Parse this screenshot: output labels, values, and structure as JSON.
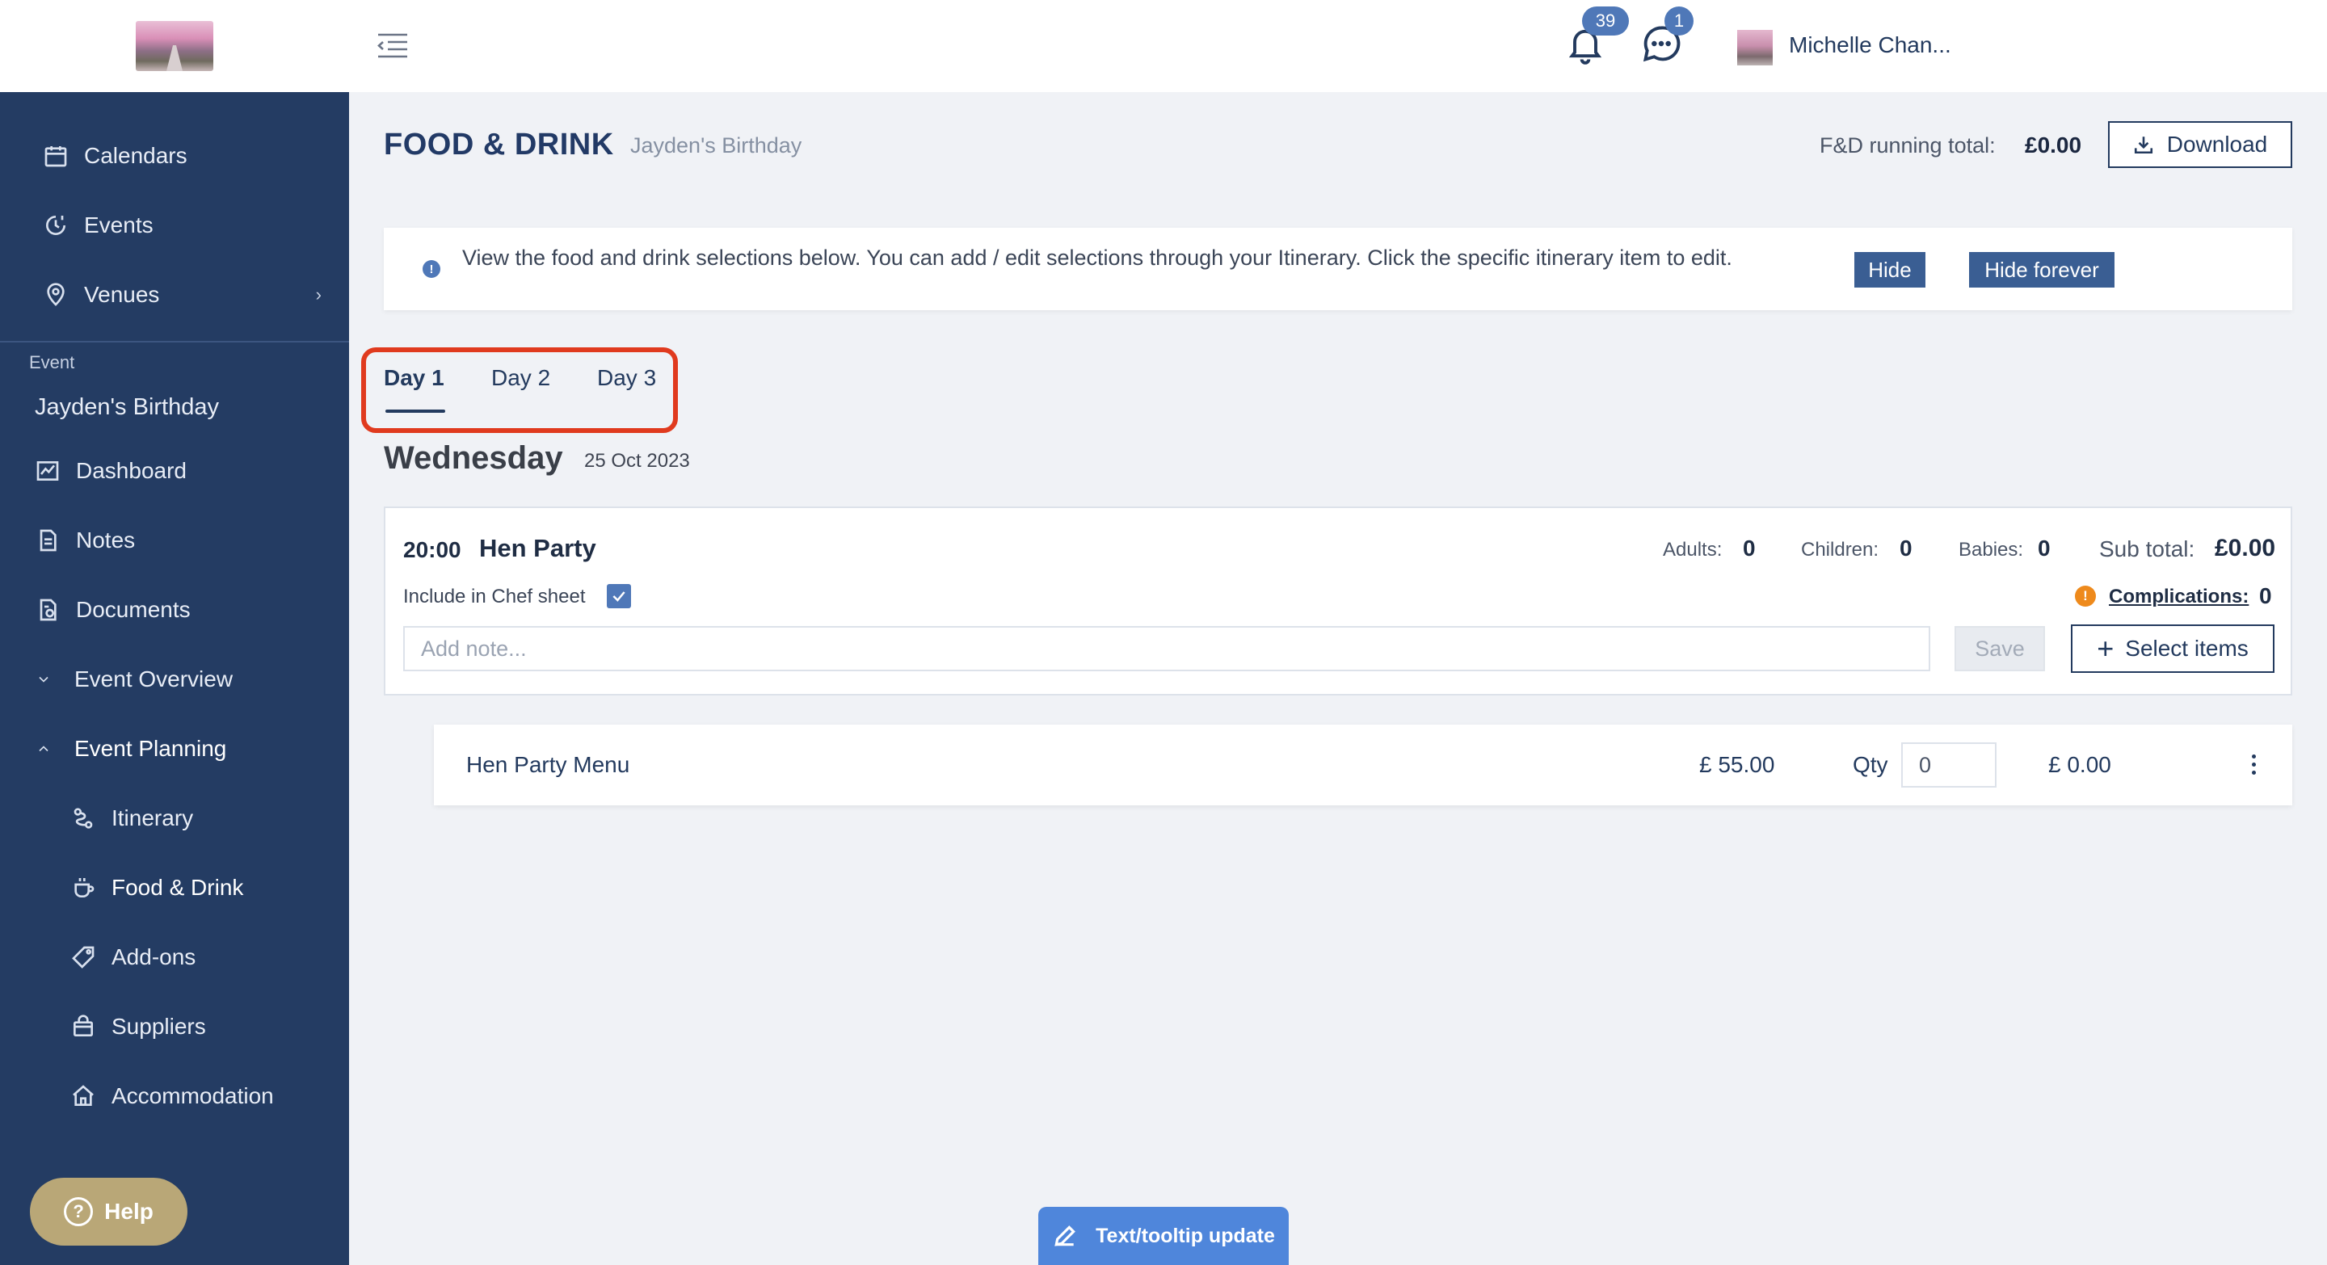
{
  "sidebar": {
    "top_items": [
      {
        "label": "Calendars",
        "icon": "calendar-icon"
      },
      {
        "label": "Events",
        "icon": "events-icon"
      },
      {
        "label": "Venues",
        "icon": "location-pin-icon"
      }
    ],
    "section_label": "Event",
    "event_name": "Jayden's Birthday",
    "event_items": [
      {
        "label": "Dashboard",
        "icon": "chart-icon"
      },
      {
        "label": "Notes",
        "icon": "notes-icon"
      },
      {
        "label": "Documents",
        "icon": "documents-icon"
      },
      {
        "label": "Event Overview",
        "icon": "chevron-down-icon"
      },
      {
        "label": "Event Planning",
        "icon": "chevron-up-icon"
      },
      {
        "label": "Itinerary",
        "icon": "itinerary-icon"
      },
      {
        "label": "Food & Drink",
        "icon": "cup-icon",
        "active": true
      },
      {
        "label": "Add-ons",
        "icon": "tag-icon"
      },
      {
        "label": "Suppliers",
        "icon": "bag-icon"
      },
      {
        "label": "Accommodation",
        "icon": "house-icon"
      }
    ],
    "help_label": "Help"
  },
  "topbar": {
    "notifications_count": "39",
    "messages_count": "1",
    "user_name": "Michelle Chan..."
  },
  "page": {
    "title": "FOOD & DRINK",
    "subtitle": "Jayden's Birthday",
    "running_total_label": "F&D running total:",
    "running_total_value": "£0.00",
    "download_label": "Download"
  },
  "info": {
    "text": "View the food and drink selections below. You can add / edit selections through your Itinerary. Click the specific itinerary item to edit.",
    "hide_label": "Hide",
    "hide_forever_label": "Hide forever"
  },
  "tabs": [
    "Day 1",
    "Day 2",
    "Day 3"
  ],
  "day": {
    "name": "Wednesday",
    "date": "25 Oct 2023"
  },
  "event_item": {
    "time": "20:00",
    "title": "Hen Party",
    "adults_label": "Adults:",
    "adults": "0",
    "children_label": "Children:",
    "children": "0",
    "babies_label": "Babies:",
    "babies": "0",
    "subtotal_label": "Sub total:",
    "subtotal": "£0.00",
    "chef_sheet_label": "Include in Chef sheet",
    "chef_sheet_checked": true,
    "complications_label": "Complications:",
    "complications": "0",
    "note_placeholder": "Add note...",
    "save_label": "Save",
    "select_items_label": "Select items"
  },
  "menu_row": {
    "name": "Hen Party Menu",
    "price": "£ 55.00",
    "qty_label": "Qty",
    "qty": "0",
    "total": "£ 0.00"
  },
  "tooltip_button": "Text/tooltip update",
  "colors": {
    "sidebar_bg": "#243c63",
    "accent": "#4f78b8",
    "button_dark": "#3a5e93",
    "highlight_outline": "#e03a1e",
    "warning": "#ee8a1c"
  }
}
